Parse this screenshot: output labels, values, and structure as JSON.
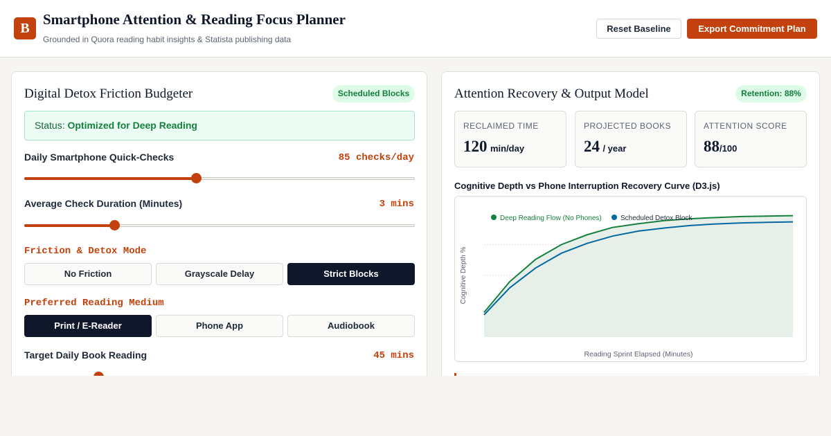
{
  "header": {
    "logo_letter": "B",
    "title": "Smartphone Attention & Reading Focus Planner",
    "subtitle": "Grounded in Quora reading habit insights & Statista publishing data",
    "reset_label": "Reset Baseline",
    "export_label": "Export Commitment Plan"
  },
  "left_panel": {
    "title": "Digital Detox Friction Budgeter",
    "badge": "Scheduled Blocks",
    "status_prefix": "Status:",
    "status_value": "Optimized for Deep Reading",
    "quick_checks": {
      "label": "Daily Smartphone Quick-Checks",
      "value_text": "85 checks/day",
      "fraction": 0.44
    },
    "check_duration": {
      "label": "Average Check Duration (Minutes)",
      "value_text": "3 mins",
      "fraction": 0.23
    },
    "friction": {
      "heading": "Friction & Detox Mode",
      "options": [
        "No Friction",
        "Grayscale Delay",
        "Strict Blocks"
      ],
      "selected": "Strict Blocks"
    },
    "medium": {
      "heading": "Preferred Reading Medium",
      "options": [
        "Print / E-Reader",
        "Phone App",
        "Audiobook"
      ],
      "selected": "Print / E-Reader"
    },
    "target_reading": {
      "label": "Target Daily Book Reading",
      "value_text": "45 mins",
      "fraction": 0.19
    }
  },
  "right_panel": {
    "title": "Attention Recovery & Output Model",
    "badge": "Retention: 88%",
    "metrics": [
      {
        "label": "RECLAIMED TIME",
        "value": "120",
        "unit": "min/day"
      },
      {
        "label": "PROJECTED BOOKS",
        "value": "24",
        "unit": "/ year"
      },
      {
        "label": "ATTENTION SCORE",
        "value": "88",
        "unit": "/100"
      }
    ],
    "chart_title": "Cognitive Depth vs Phone Interruption Recovery Curve (D3.js)"
  },
  "chart_data": {
    "type": "line",
    "title": "Cognitive Depth vs Phone Interruption Recovery Curve (D3.js)",
    "xlabel": "Reading Sprint Elapsed (Minutes)",
    "ylabel": "Cognitive Depth %",
    "xlim": [
      0,
      60
    ],
    "ylim": [
      0,
      100
    ],
    "grid": true,
    "legend_position": "top-left",
    "series": [
      {
        "name": "Deep Reading Flow (No Phones)",
        "color": "#15803d",
        "x": [
          0,
          5,
          10,
          15,
          20,
          25,
          30,
          35,
          40,
          45,
          50,
          55,
          60
        ],
        "y": [
          20,
          45,
          63,
          75,
          83,
          89,
          92,
          94.5,
          96,
          97,
          97.8,
          98.2,
          98.5
        ]
      },
      {
        "name": "Scheduled Detox Block",
        "color": "#0369a1",
        "x": [
          0,
          5,
          10,
          15,
          20,
          25,
          30,
          35,
          40,
          45,
          50,
          55,
          60
        ],
        "y": [
          18,
          40,
          56,
          68,
          76,
          82,
          86,
          88.5,
          90.5,
          91.8,
          92.6,
          93.1,
          93.5
        ]
      }
    ]
  }
}
